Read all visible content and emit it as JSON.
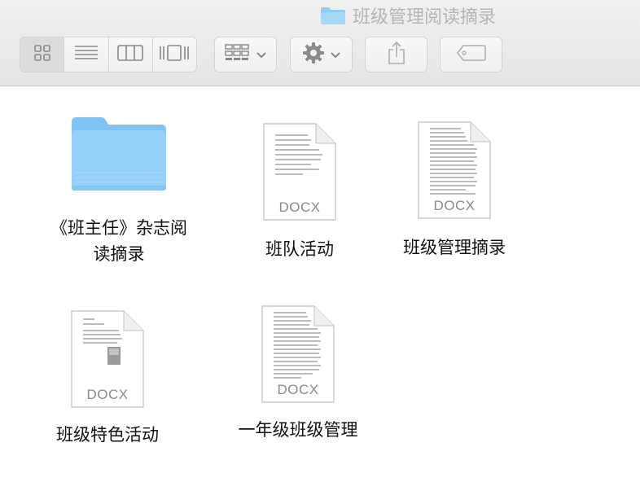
{
  "window": {
    "title": "班级管理阅读摘录"
  },
  "toolbar": {
    "view_modes": [
      {
        "name": "icon-view",
        "icon": "grid-icon",
        "selected": true
      },
      {
        "name": "list-view",
        "icon": "list-icon",
        "selected": false
      },
      {
        "name": "column-view",
        "icon": "columns-icon",
        "selected": false
      },
      {
        "name": "coverflow-view",
        "icon": "coverflow-icon",
        "selected": false
      }
    ],
    "arrange": {
      "icon": "arrange-grid-icon",
      "has_menu": true
    },
    "action": {
      "icon": "gear-icon",
      "has_menu": true
    },
    "share": {
      "icon": "share-icon"
    },
    "tags": {
      "icon": "tag-icon"
    }
  },
  "files": [
    {
      "name": "《班主任》杂志阅读摘录",
      "line1": "《班主任》杂志阅",
      "line2": "读摘录",
      "kind": "folder"
    },
    {
      "name": "班队活动",
      "kind": "docx",
      "ext": "DOCX"
    },
    {
      "name": "班级管理摘录",
      "kind": "docx",
      "ext": "DOCX"
    },
    {
      "name": "班级特色活动",
      "kind": "docx",
      "ext": "DOCX"
    },
    {
      "name": "一年级班级管理",
      "kind": "docx",
      "ext": "DOCX"
    }
  ],
  "colors": {
    "folder_blue": "#7cc3f3",
    "folder_tab": "#9ad2f7",
    "title_gray": "#b5b5b5"
  }
}
